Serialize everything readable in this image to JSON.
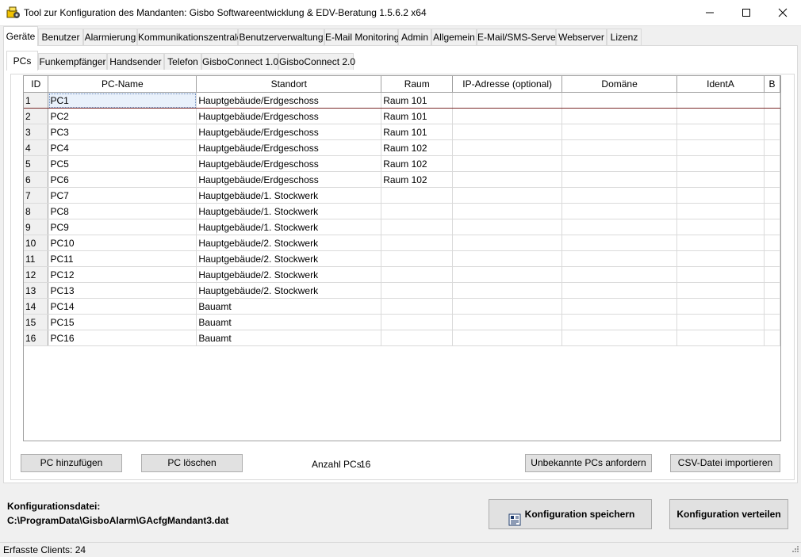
{
  "window": {
    "title": "Tool zur Konfiguration des Mandanten: Gisbo Softwareentwicklung & EDV-Beratung 1.5.6.2 x64"
  },
  "main_tabs": [
    {
      "label": "Geräte",
      "active": true
    },
    {
      "label": "Benutzer"
    },
    {
      "label": "Alarmierung"
    },
    {
      "label": "Kommunikationszentrale"
    },
    {
      "label": "Benutzerverwaltung"
    },
    {
      "label": "E-Mail Monitoring"
    },
    {
      "label": "Admin"
    },
    {
      "label": "Allgemein"
    },
    {
      "label": "E-Mail/SMS-Server"
    },
    {
      "label": "Webserver"
    },
    {
      "label": "Lizenz"
    }
  ],
  "sub_tabs": [
    {
      "label": "PCs",
      "active": true
    },
    {
      "label": "Funkempfänger"
    },
    {
      "label": "Handsender"
    },
    {
      "label": "Telefon"
    },
    {
      "label": "GisboConnect 1.0"
    },
    {
      "label": "GisboConnect 2.0"
    }
  ],
  "grid": {
    "columns": [
      "ID",
      "PC-Name",
      "Standort",
      "Raum",
      "IP-Adresse (optional)",
      "Domäne",
      "IdentA",
      "B"
    ],
    "rows": [
      [
        "1",
        "PC1",
        "Hauptgebäude/Erdgeschoss",
        "Raum 101",
        "",
        "",
        "",
        ""
      ],
      [
        "2",
        "PC2",
        "Hauptgebäude/Erdgeschoss",
        "Raum 101",
        "",
        "",
        "",
        ""
      ],
      [
        "3",
        "PC3",
        "Hauptgebäude/Erdgeschoss",
        "Raum 101",
        "",
        "",
        "",
        ""
      ],
      [
        "4",
        "PC4",
        "Hauptgebäude/Erdgeschoss",
        "Raum 102",
        "",
        "",
        "",
        ""
      ],
      [
        "5",
        "PC5",
        "Hauptgebäude/Erdgeschoss",
        "Raum 102",
        "",
        "",
        "",
        ""
      ],
      [
        "6",
        "PC6",
        "Hauptgebäude/Erdgeschoss",
        "Raum 102",
        "",
        "",
        "",
        ""
      ],
      [
        "7",
        "PC7",
        "Hauptgebäude/1. Stockwerk",
        "",
        "",
        "",
        "",
        ""
      ],
      [
        "8",
        "PC8",
        "Hauptgebäude/1. Stockwerk",
        "",
        "",
        "",
        "",
        ""
      ],
      [
        "9",
        "PC9",
        "Hauptgebäude/1. Stockwerk",
        "",
        "",
        "",
        "",
        ""
      ],
      [
        "10",
        "PC10",
        "Hauptgebäude/2. Stockwerk",
        "",
        "",
        "",
        "",
        ""
      ],
      [
        "11",
        "PC11",
        "Hauptgebäude/2. Stockwerk",
        "",
        "",
        "",
        "",
        ""
      ],
      [
        "12",
        "PC12",
        "Hauptgebäude/2. Stockwerk",
        "",
        "",
        "",
        "",
        ""
      ],
      [
        "13",
        "PC13",
        "Hauptgebäude/2. Stockwerk",
        "",
        "",
        "",
        "",
        ""
      ],
      [
        "14",
        "PC14",
        "Bauamt",
        "",
        "",
        "",
        "",
        ""
      ],
      [
        "15",
        "PC15",
        "Bauamt",
        "",
        "",
        "",
        "",
        ""
      ],
      [
        "16",
        "PC16",
        "Bauamt",
        "",
        "",
        "",
        "",
        ""
      ]
    ]
  },
  "actions": {
    "add_pc": "PC hinzufügen",
    "delete_pc": "PC löschen",
    "count_label": "Anzahl PCs:",
    "count_value": "16",
    "request_unknown": "Unbekannte PCs anfordern",
    "import_csv": "CSV-Datei importieren"
  },
  "config": {
    "file_label": "Konfigurationsdatei:",
    "file_path": "C:\\ProgramData\\GisboAlarm\\GAcfgMandant3.dat",
    "save_label": "Konfiguration speichern",
    "distribute_label": "Konfiguration verteilen"
  },
  "status": {
    "text": "Erfasste Clients: 24"
  },
  "colors": {
    "window_bg": "#f0f0f0",
    "selected_row_border": "#7a2b2b",
    "button_bg": "#e1e1e1"
  }
}
